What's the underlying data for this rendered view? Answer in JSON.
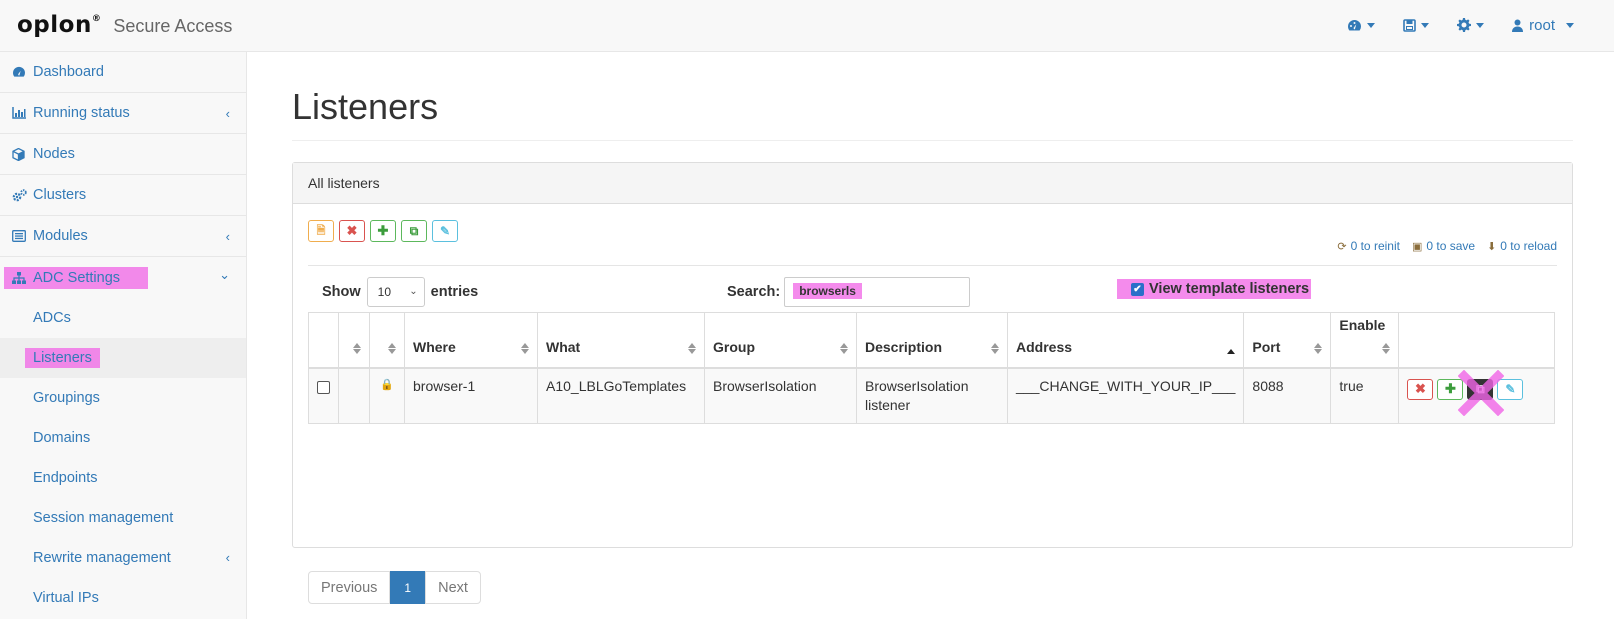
{
  "app": {
    "logo": "oplon",
    "logo_mark": "®",
    "subtitle": "Secure Access"
  },
  "topnav": {
    "user": "root"
  },
  "sidebar": {
    "items": [
      {
        "label": "Dashboard"
      },
      {
        "label": "Running status"
      },
      {
        "label": "Nodes"
      },
      {
        "label": "Clusters"
      },
      {
        "label": "Modules"
      },
      {
        "label": "ADC Settings"
      }
    ],
    "subitems": [
      {
        "label": "ADCs"
      },
      {
        "label": "Listeners"
      },
      {
        "label": "Groupings"
      },
      {
        "label": "Domains"
      },
      {
        "label": "Endpoints"
      },
      {
        "label": "Session management"
      },
      {
        "label": "Rewrite management"
      },
      {
        "label": "Virtual IPs"
      }
    ]
  },
  "page": {
    "title": "Listeners",
    "panel_title": "All listeners"
  },
  "counters": {
    "reinit": "0 to reinit",
    "save": "0 to save",
    "reload": "0 to reload"
  },
  "controls": {
    "show_label": "Show",
    "entries_value": "10",
    "entries_label": "entries",
    "search_label": "Search:",
    "search_value": "browserls",
    "template_label": "View template listeners"
  },
  "table": {
    "headers": [
      "Where",
      "What",
      "Group",
      "Description",
      "Address",
      "Port",
      "Enable"
    ],
    "rows": [
      {
        "where": "browser-1",
        "what": "A10_LBLGoTemplates",
        "group": "BrowserIsolation",
        "description": "BrowserIsolation listener",
        "address": "___CHANGE_WITH_YOUR_IP___",
        "port": "8088",
        "enable": "true"
      }
    ]
  },
  "pagination": {
    "previous": "Previous",
    "current": "1",
    "next": "Next"
  },
  "colors": {
    "link": "#337ab7",
    "highlight": "#f064e6",
    "primary": "#337ab7"
  }
}
